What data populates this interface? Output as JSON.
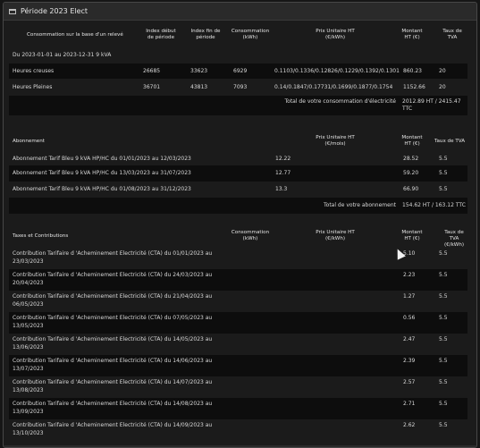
{
  "window": {
    "title": "Période 2023 Elect"
  },
  "conso": {
    "headers": {
      "label": "Consommation sur la base d'un relevé",
      "index_debut": "Index début de période",
      "index_fin": "Index fin de période",
      "consommation": "Consommation (kWh)",
      "prix": "Prix Unitaire HT (€/kWh)",
      "montant": "Montant HT (€)",
      "tva": "Taux de TVA"
    },
    "period": "Du 2023-01-01 au 2023-12-31 9 kVA",
    "rows": [
      {
        "label": "Heures creuses",
        "debut": "26685",
        "fin": "33623",
        "conso": "6929",
        "prix": "0.1103/0.1336/0.12826/0.1229/0.1392/0.1301",
        "montant": "860.23",
        "tva": "20"
      },
      {
        "label": "Heures Pleines",
        "debut": "36701",
        "fin": "43813",
        "conso": "7093",
        "prix": "0.14/0.1847/0.17731/0.1699/0.1877/0.1754",
        "montant": "1152.66",
        "tva": "20"
      }
    ],
    "total_label": "Total de votre consommation d'électricité",
    "total_value": "2012.89 HT / 2415.47 TTC"
  },
  "abonnement": {
    "headers": {
      "label": "Abonnement",
      "prix": "Prix Unitaire HT (€/mois)",
      "montant": "Montant HT (€)",
      "tva": "Taux de TVA"
    },
    "rows": [
      {
        "label": "Abonnement Tarif Bleu 9 kVA HP/HC du 01/01/2023 au 12/03/2023",
        "prix": "12.22",
        "montant": "28.52",
        "tva": "5.5"
      },
      {
        "label": "Abonnement Tarif Bleu 9 kVA HP/HC du 13/03/2023 au 31/07/2023",
        "prix": "12.77",
        "montant": "59.20",
        "tva": "5.5"
      },
      {
        "label": "Abonnement Tarif Bleu 9 kVA HP/HC du 01/08/2023 au 31/12/2023",
        "prix": "13.3",
        "montant": "66.90",
        "tva": "5.5"
      }
    ],
    "total_label": "Total de votre abonnement",
    "total_value": "154.62 HT / 163.12 TTC"
  },
  "taxes": {
    "headers": {
      "label": "Taxes et Contributions",
      "consommation": "Consommation (kWh)",
      "prix": "Prix Unitaire HT (€/kWh)",
      "montant": "Montant HT (€)",
      "tva": "Taux de TVA (€/kWh)"
    },
    "rows": [
      {
        "l1": "Contribution Tarifaire d 'Acheminement Electricité (CTA) du 01/01/2023 au",
        "l2": "23/03/2023",
        "montant": "5.10",
        "tva": "5.5"
      },
      {
        "l1": "Contribution Tarifaire d 'Acheminement Electricité (CTA) du 24/03/2023 au",
        "l2": "20/04/2023",
        "montant": "2.23",
        "tva": "5.5"
      },
      {
        "l1": "Contribution Tarifaire d 'Acheminement Electricité (CTA) du 21/04/2023 au",
        "l2": "06/05/2023",
        "montant": "1.27",
        "tva": "5.5"
      },
      {
        "l1": "Contribution Tarifaire d 'Acheminement Electricité (CTA) du 07/05/2023 au",
        "l2": "13/05/2023",
        "montant": "0.56",
        "tva": "5.5"
      },
      {
        "l1": "Contribution Tarifaire d 'Acheminement Electricité (CTA) du 14/05/2023 au",
        "l2": "13/06/2023",
        "montant": "2.47",
        "tva": "5.5"
      },
      {
        "l1": "Contribution Tarifaire d 'Acheminement Electricité (CTA) du 14/06/2023 au",
        "l2": "13/07/2023",
        "montant": "2.39",
        "tva": "5.5"
      },
      {
        "l1": "Contribution Tarifaire d 'Acheminement Electricité (CTA) du 14/07/2023 au",
        "l2": "13/08/2023",
        "montant": "2.57",
        "tva": "5.5"
      },
      {
        "l1": "Contribution Tarifaire d 'Acheminement Electricité (CTA) du 14/08/2023 au",
        "l2": "13/09/2023",
        "montant": "2.71",
        "tva": "5.5"
      },
      {
        "l1": "Contribution Tarifaire d 'Acheminement Electricité (CTA) du 14/09/2023 au",
        "l2": "13/10/2023",
        "montant": "2.62",
        "tva": "5.5"
      }
    ]
  }
}
